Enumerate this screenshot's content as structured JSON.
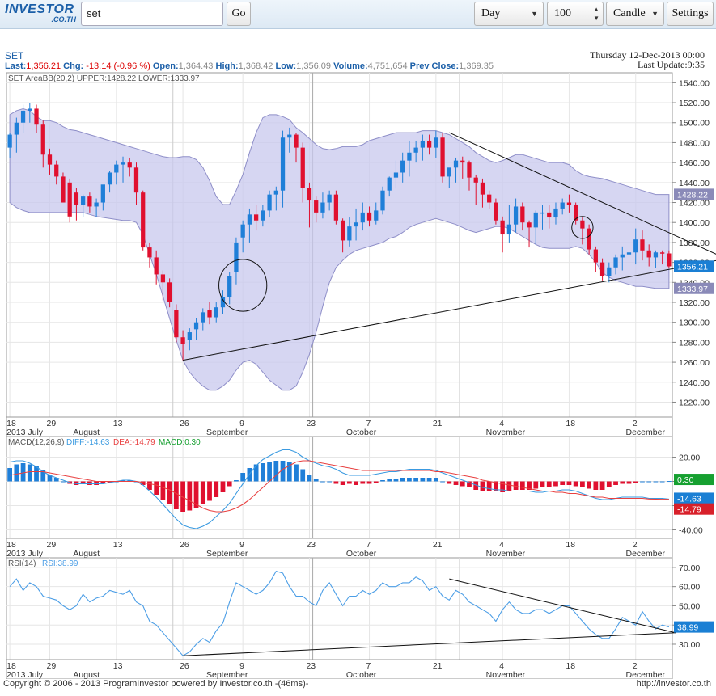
{
  "toolbar": {
    "logo_main": "INVESTOR",
    "logo_sub": ".CO.TH",
    "search_value": "set",
    "go_label": "Go",
    "period_value": "Day",
    "count_value": "100",
    "style_value": "Candle",
    "settings_label": "Settings"
  },
  "header": {
    "symbol": "SET",
    "last_label": "Last:",
    "last": "1,356.21",
    "chg_label": "Chg:",
    "chg": "-13.14 (-0.96 %)",
    "open_label": "Open:",
    "open": "1,364.43",
    "high_label": "High:",
    "high": "1,368.42",
    "low_label": "Low:",
    "low": "1,356.09",
    "volume_label": "Volume:",
    "volume": "4,751,654",
    "prev_label": "Prev Close:",
    "prev": "1,369.35",
    "date": "Thursday 12-Dec-2013 00:00",
    "last_update_label": "Last Update:",
    "last_update": "9:35"
  },
  "colors": {
    "up": "#1f7fd8",
    "down": "#e0102f",
    "band": "#c8c8ee",
    "band_line": "#8e8ec8",
    "diff": "#3a9ae0",
    "dea": "#e84040",
    "rsi": "#4c9ee6",
    "badge_blue": "#1a7fd4",
    "badge_red": "#d8202a",
    "badge_green": "#16a030"
  },
  "chart_data": [
    {
      "type": "candlestick",
      "legend": "SET  AreaBB(20,2) UPPER:1428.22 LOWER:1333.97",
      "yticks": [
        1220,
        1240,
        1260,
        1280,
        1300,
        1320,
        1340,
        1360,
        1380,
        1400,
        1420,
        1440,
        1460,
        1480,
        1500,
        1520,
        1540
      ],
      "ylim": [
        1205,
        1550
      ],
      "tags": {
        "upper": "1428.22",
        "last": "1356.21",
        "lower": "1333.97"
      },
      "open": [
        1475,
        1488,
        1500,
        1512,
        1514,
        1498,
        1468,
        1458,
        1446,
        1440,
        1430,
        1418,
        1426,
        1416,
        1420,
        1438,
        1450,
        1458,
        1460,
        1455,
        1430,
        1375,
        1365,
        1348,
        1340,
        1312,
        1285,
        1282,
        1293,
        1300,
        1312,
        1305,
        1315,
        1325,
        1350,
        1385,
        1398,
        1408,
        1402,
        1412,
        1428,
        1432,
        1485,
        1488,
        1475,
        1435,
        1422,
        1410,
        1420,
        1428,
        1402,
        1382,
        1396,
        1400,
        1410,
        1402,
        1412,
        1432,
        1445,
        1450,
        1462,
        1470,
        1475,
        1482,
        1475,
        1485,
        1446,
        1455,
        1462,
        1460,
        1445,
        1440,
        1428,
        1420,
        1402,
        1388,
        1398,
        1416,
        1400,
        1395,
        1410,
        1410,
        1405,
        1414,
        1420,
        1418,
        1402,
        1394,
        1373,
        1360,
        1346,
        1355,
        1365,
        1368,
        1370,
        1383,
        1372,
        1365,
        1370,
        1369
      ],
      "high": [
        1490,
        1505,
        1518,
        1520,
        1518,
        1502,
        1474,
        1462,
        1450,
        1444,
        1435,
        1428,
        1430,
        1424,
        1432,
        1452,
        1462,
        1466,
        1465,
        1460,
        1432,
        1380,
        1372,
        1352,
        1344,
        1318,
        1292,
        1294,
        1304,
        1314,
        1320,
        1320,
        1332,
        1350,
        1385,
        1402,
        1414,
        1418,
        1418,
        1432,
        1436,
        1492,
        1495,
        1490,
        1480,
        1440,
        1426,
        1430,
        1432,
        1432,
        1404,
        1405,
        1414,
        1420,
        1416,
        1420,
        1436,
        1446,
        1462,
        1470,
        1482,
        1482,
        1488,
        1488,
        1492,
        1490,
        1452,
        1465,
        1466,
        1462,
        1448,
        1444,
        1432,
        1424,
        1406,
        1418,
        1424,
        1420,
        1402,
        1412,
        1418,
        1418,
        1420,
        1424,
        1428,
        1420,
        1405,
        1398,
        1376,
        1364,
        1360,
        1368,
        1376,
        1384,
        1394,
        1392,
        1378,
        1372,
        1372,
        1372
      ],
      "low": [
        1465,
        1470,
        1490,
        1500,
        1490,
        1455,
        1448,
        1438,
        1420,
        1400,
        1402,
        1405,
        1410,
        1406,
        1412,
        1430,
        1438,
        1440,
        1446,
        1418,
        1372,
        1355,
        1338,
        1322,
        1315,
        1280,
        1262,
        1272,
        1282,
        1292,
        1298,
        1300,
        1308,
        1318,
        1338,
        1370,
        1380,
        1392,
        1396,
        1405,
        1412,
        1415,
        1470,
        1460,
        1420,
        1395,
        1400,
        1404,
        1412,
        1398,
        1370,
        1376,
        1382,
        1392,
        1396,
        1398,
        1408,
        1426,
        1434,
        1440,
        1446,
        1460,
        1462,
        1468,
        1465,
        1440,
        1435,
        1440,
        1444,
        1432,
        1418,
        1415,
        1414,
        1398,
        1370,
        1380,
        1390,
        1392,
        1375,
        1378,
        1393,
        1394,
        1398,
        1408,
        1410,
        1398,
        1378,
        1368,
        1350,
        1342,
        1340,
        1348,
        1352,
        1352,
        1358,
        1362,
        1356,
        1354,
        1358,
        1354
      ],
      "close": [
        1488,
        1500,
        1512,
        1514,
        1498,
        1468,
        1458,
        1446,
        1420,
        1406,
        1418,
        1426,
        1416,
        1420,
        1438,
        1450,
        1458,
        1460,
        1455,
        1430,
        1375,
        1365,
        1348,
        1340,
        1320,
        1285,
        1278,
        1290,
        1300,
        1310,
        1305,
        1315,
        1325,
        1346,
        1380,
        1398,
        1408,
        1402,
        1412,
        1428,
        1432,
        1485,
        1488,
        1475,
        1435,
        1422,
        1410,
        1420,
        1428,
        1402,
        1382,
        1396,
        1400,
        1410,
        1402,
        1412,
        1432,
        1445,
        1450,
        1462,
        1470,
        1475,
        1482,
        1475,
        1485,
        1446,
        1455,
        1462,
        1460,
        1445,
        1440,
        1428,
        1420,
        1402,
        1388,
        1398,
        1416,
        1400,
        1395,
        1410,
        1410,
        1405,
        1414,
        1420,
        1418,
        1402,
        1394,
        1373,
        1360,
        1346,
        1355,
        1365,
        1368,
        1370,
        1383,
        1372,
        1365,
        1370,
        1369,
        1356
      ],
      "bb_upper": [
        1508,
        1512,
        1514,
        1512,
        1506,
        1502,
        1502,
        1500,
        1496,
        1493,
        1492,
        1490,
        1488,
        1486,
        1484,
        1482,
        1480,
        1478,
        1476,
        1474,
        1472,
        1470,
        1468,
        1466,
        1465,
        1465,
        1466,
        1466,
        1463,
        1455,
        1442,
        1426,
        1418,
        1418,
        1432,
        1448,
        1470,
        1490,
        1505,
        1508,
        1508,
        1506,
        1503,
        1495,
        1490,
        1484,
        1478,
        1474,
        1473,
        1474,
        1476,
        1476,
        1476,
        1478,
        1482,
        1484,
        1486,
        1488,
        1490,
        1490,
        1490,
        1490,
        1492,
        1492,
        1492,
        1490,
        1488,
        1484,
        1480,
        1476,
        1470,
        1466,
        1462,
        1460,
        1462,
        1465,
        1468,
        1468,
        1466,
        1464,
        1462,
        1460,
        1460,
        1460,
        1458,
        1452,
        1448,
        1446,
        1445,
        1444,
        1442,
        1440,
        1438,
        1436,
        1434,
        1432,
        1430,
        1428,
        1428,
        1428
      ],
      "bb_lower": [
        1420,
        1415,
        1412,
        1410,
        1410,
        1410,
        1410,
        1410,
        1410,
        1410,
        1410,
        1410,
        1408,
        1406,
        1405,
        1404,
        1403,
        1402,
        1402,
        1400,
        1388,
        1368,
        1348,
        1326,
        1304,
        1282,
        1262,
        1250,
        1242,
        1236,
        1232,
        1232,
        1236,
        1242,
        1252,
        1260,
        1262,
        1258,
        1250,
        1242,
        1237,
        1232,
        1232,
        1236,
        1250,
        1268,
        1290,
        1316,
        1340,
        1355,
        1362,
        1368,
        1372,
        1374,
        1376,
        1378,
        1380,
        1384,
        1386,
        1390,
        1395,
        1398,
        1400,
        1402,
        1404,
        1402,
        1400,
        1398,
        1395,
        1392,
        1390,
        1392,
        1394,
        1396,
        1396,
        1394,
        1390,
        1386,
        1382,
        1378,
        1375,
        1374,
        1374,
        1374,
        1374,
        1376,
        1374,
        1368,
        1360,
        1350,
        1345,
        1342,
        1340,
        1338,
        1336,
        1336,
        1335,
        1334,
        1334,
        1334
      ],
      "trendlines": [
        [
          26,
          1262,
          100,
          1362
        ],
        [
          66,
          1490,
          100,
          1368
        ]
      ],
      "ellipses": [
        [
          35,
          1337,
          3.6,
          26
        ],
        [
          86,
          1395,
          1.6,
          11
        ]
      ]
    },
    {
      "type": "bar+line",
      "legend_name": "MACD(12,26,9)",
      "legend_diff": "DIFF:-14.63",
      "legend_dea": "DEA:-14.79",
      "legend_macd": "MACD:0.30",
      "yticks": [
        20,
        0,
        -20,
        -40
      ],
      "ylim": [
        -47,
        37
      ],
      "tags": {
        "macd": "0.30",
        "diff": "-14.63",
        "dea": "-14.79"
      },
      "macd": [
        11,
        14,
        15,
        14,
        13,
        9,
        5,
        3,
        0,
        -2,
        -3,
        -2,
        -3,
        -3,
        -2,
        -1,
        0,
        1,
        1,
        0,
        -3,
        -7,
        -11,
        -15,
        -19,
        -23,
        -25,
        -24,
        -22,
        -19,
        -16,
        -13,
        -9,
        -4,
        1,
        7,
        11,
        14,
        15,
        16,
        17,
        17,
        16,
        14,
        10,
        5,
        2,
        0,
        0,
        -2,
        -3,
        -2,
        -3,
        -2,
        -2,
        -1,
        1,
        2,
        2,
        3,
        3,
        3,
        3,
        3,
        3,
        0,
        -2,
        -3,
        -4,
        -5,
        -7,
        -8,
        -8,
        -8,
        -9,
        -8,
        -7,
        -7,
        -7,
        -6,
        -5,
        -5,
        -4,
        -3,
        -3,
        -4,
        -5,
        -6,
        -7,
        -7,
        -5,
        -3,
        -2,
        -2,
        -1,
        0,
        0,
        0,
        0,
        0.3
      ],
      "diff": [
        16,
        17,
        17,
        15,
        12,
        8,
        5,
        3,
        1,
        -1,
        -2,
        -2,
        -2,
        -2,
        -2,
        -1,
        0,
        1,
        1,
        0,
        -3,
        -8,
        -13,
        -19,
        -25,
        -31,
        -36,
        -38,
        -39,
        -37,
        -34,
        -29,
        -24,
        -18,
        -10,
        -2,
        6,
        13,
        18,
        21,
        24,
        26,
        26,
        24,
        20,
        17,
        15,
        13,
        12,
        10,
        7,
        5,
        5,
        5,
        5,
        6,
        7,
        8,
        8,
        9,
        10,
        10,
        10,
        10,
        9,
        7,
        5,
        3,
        1,
        -1,
        -3,
        -5,
        -6,
        -7,
        -7,
        -8,
        -8,
        -8,
        -8,
        -9,
        -9,
        -8,
        -8,
        -7,
        -7,
        -8,
        -10,
        -12,
        -14,
        -15,
        -15,
        -14,
        -13,
        -13,
        -13,
        -13,
        -14,
        -14,
        -14,
        -14.63
      ],
      "dea": [
        5,
        6,
        7,
        8,
        8,
        8,
        7,
        6,
        5,
        4,
        3,
        2,
        1,
        0,
        0,
        0,
        0,
        0,
        0,
        0,
        -1,
        -2,
        -3,
        -5,
        -7,
        -10,
        -13,
        -16,
        -19,
        -22,
        -24,
        -25,
        -25,
        -24,
        -22,
        -19,
        -15,
        -10,
        -5,
        0,
        5,
        10,
        13,
        16,
        17,
        17,
        16,
        15,
        14,
        13,
        12,
        11,
        10,
        9,
        9,
        9,
        9,
        9,
        9,
        9,
        9,
        9,
        9,
        9,
        8,
        8,
        7,
        6,
        5,
        4,
        3,
        1,
        0,
        -1,
        -2,
        -3,
        -4,
        -5,
        -6,
        -7,
        -8,
        -8,
        -9,
        -9,
        -10,
        -10,
        -11,
        -12,
        -13,
        -13,
        -14,
        -14,
        -14,
        -14,
        -14,
        -14,
        -14.5,
        -14.7,
        -14.8,
        -14.79
      ]
    },
    {
      "type": "line",
      "legend_name": "RSI(14)",
      "legend_value": "RSI:38.99",
      "yticks": [
        30,
        40,
        50,
        60,
        70
      ],
      "ylim": [
        22,
        75
      ],
      "tags": {
        "rsi": "38.99"
      },
      "rsi": [
        60,
        64,
        58,
        62,
        60,
        55,
        54,
        53,
        50,
        48,
        50,
        56,
        52,
        54,
        55,
        58,
        57,
        56,
        58,
        52,
        50,
        42,
        40,
        36,
        32,
        28,
        24,
        26,
        30,
        33,
        31,
        37,
        41,
        52,
        62,
        60,
        58,
        56,
        58,
        62,
        68,
        67,
        60,
        55,
        55,
        52,
        50,
        58,
        62,
        56,
        50,
        55,
        55,
        58,
        56,
        58,
        62,
        60,
        60,
        62,
        62,
        65,
        63,
        58,
        60,
        55,
        53,
        58,
        56,
        52,
        50,
        48,
        46,
        42,
        48,
        52,
        48,
        46,
        46,
        48,
        48,
        46,
        48,
        50,
        50,
        46,
        42,
        38,
        35,
        33,
        33,
        38,
        44,
        42,
        40,
        47,
        42,
        38,
        40,
        38.99
      ],
      "trendlines": [
        [
          26,
          24,
          100,
          36
        ],
        [
          66,
          64,
          100,
          36
        ]
      ]
    }
  ],
  "x_axis": {
    "ticks": [
      [
        0,
        "18"
      ],
      [
        6,
        "29"
      ],
      [
        16,
        "13"
      ],
      [
        26,
        "26"
      ],
      [
        35,
        "9"
      ],
      [
        45,
        "23"
      ],
      [
        54,
        "7"
      ],
      [
        64,
        "21"
      ],
      [
        74,
        "4"
      ],
      [
        84,
        "18"
      ],
      [
        94,
        "2"
      ]
    ],
    "months": [
      [
        0,
        "2013 July"
      ],
      [
        10,
        "August"
      ],
      [
        30,
        "September"
      ],
      [
        51,
        "October"
      ],
      [
        72,
        "November"
      ],
      [
        93,
        "December"
      ]
    ]
  },
  "footer": {
    "copyright": "Copyright © 2006 - 2013 ProgramInvestor powered by Investor.co.th -(46ms)-",
    "url": "http://investor.co.th"
  }
}
